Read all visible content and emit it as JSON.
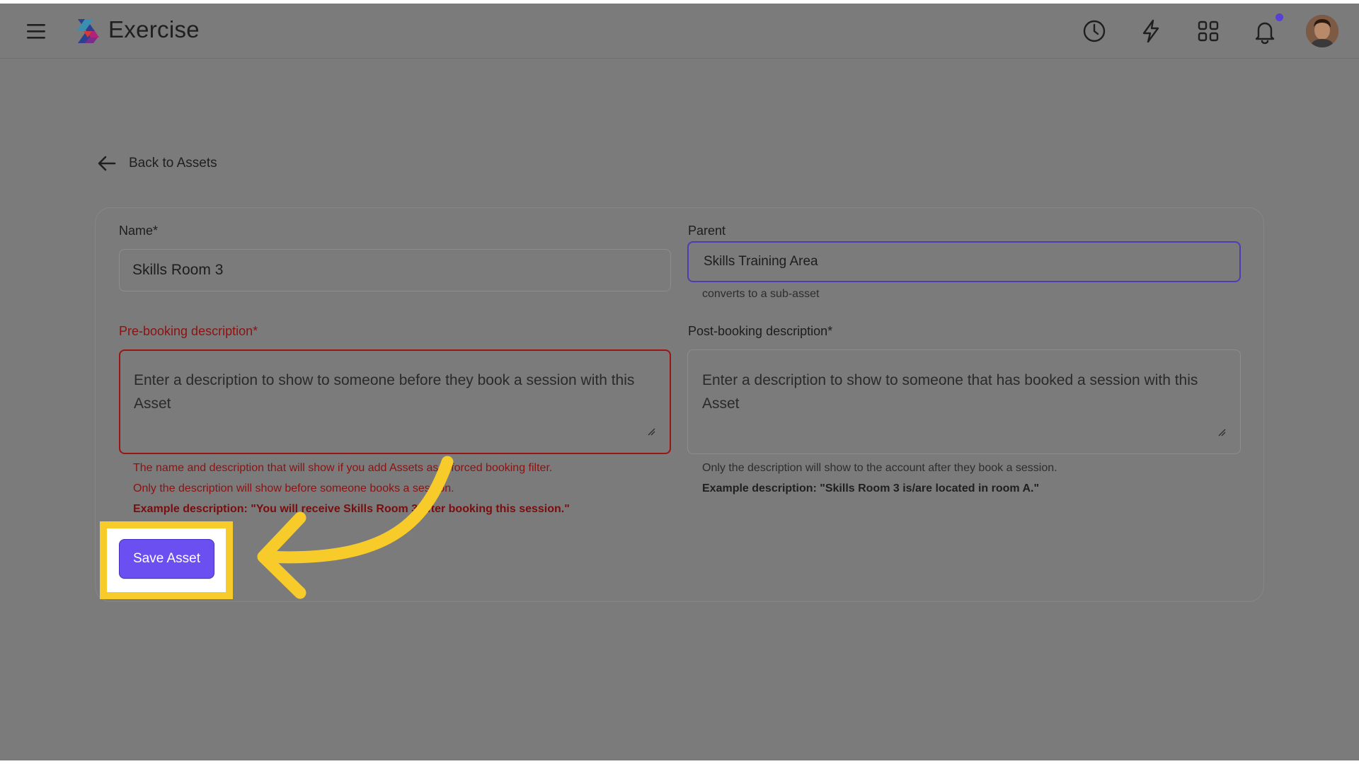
{
  "app": {
    "title": "Exercise"
  },
  "header": {
    "icons": [
      "menu-icon",
      "history-clock-icon",
      "lightning-icon",
      "apps-grid-icon",
      "bell-icon"
    ],
    "notification_dot_color": "#5a3fd1"
  },
  "nav": {
    "back_label": "Back to Assets"
  },
  "form": {
    "name": {
      "label": "Name*",
      "value": "Skills Room 3"
    },
    "parent": {
      "label": "Parent",
      "value": "Skills Training Area",
      "helper": "converts to a sub-asset"
    },
    "pre_booking": {
      "label": "Pre-booking description*",
      "placeholder": "Enter a description to show to someone before they book a session with this Asset",
      "helper_1": "The name and description that will show if you add Assets as a forced booking filter.",
      "helper_2": "Only the description will show before someone books a session.",
      "example": "Example description: \"You will receive Skills Room 3 after booking this session.\""
    },
    "post_booking": {
      "label": "Post-booking description*",
      "placeholder": "Enter a description to show to someone that has booked a session with this Asset",
      "helper_1": "Only the description will show to the account after they book a session.",
      "example": "Example description: \"Skills Room 3 is/are located in room A.\""
    },
    "save_label": "Save Asset"
  },
  "colors": {
    "overlay_bg": "#7b7b7b",
    "accent": "#6b4ff0",
    "error": "#8c1212",
    "highlight": "#f7cc2a"
  }
}
